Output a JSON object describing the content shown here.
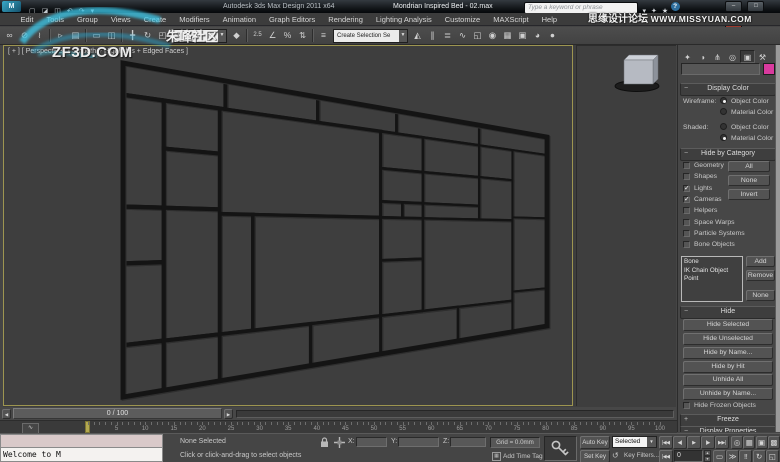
{
  "window": {
    "app_title": "Autodesk 3ds Max Design 2011 x64",
    "file_title": "Mondrian Inspired Bed - 02.max",
    "search_placeholder": "Type a keyword or phrase",
    "logo_text": "M",
    "buttons": {
      "minimize": "–",
      "maximize": "□",
      "close": "✕"
    },
    "qat_icons": [
      {
        "name": "new-scene-icon",
        "glyph": "▢"
      },
      {
        "name": "open-file-icon",
        "glyph": "◪"
      },
      {
        "name": "save-file-icon",
        "glyph": "◫"
      },
      {
        "name": "undo-icon",
        "glyph": "↶"
      },
      {
        "name": "redo-icon",
        "glyph": "↷"
      },
      {
        "name": "project-folder-icon",
        "glyph": "▾"
      }
    ],
    "infocenter_icons": [
      {
        "name": "search-go-icon",
        "glyph": "▾"
      },
      {
        "name": "communication-center-icon",
        "glyph": "✦"
      },
      {
        "name": "favorites-icon",
        "glyph": "★"
      },
      {
        "name": "help-icon",
        "glyph": "?"
      }
    ]
  },
  "watermarks": {
    "top_right_cn": "思缘设计论坛",
    "top_right_en": "WWW.MISSYUAN.COM",
    "toolbar_cn": "朱峰社区",
    "viewport_site": "ZF3D.COM"
  },
  "menus": [
    "Edit",
    "Tools",
    "Group",
    "Views",
    "Create",
    "Modifiers",
    "Animation",
    "Graph Editors",
    "Rendering",
    "Lighting Analysis",
    "Customize",
    "MAXScript",
    "Help"
  ],
  "toolbar": {
    "view_dropdown": "View",
    "selection_set_dropdown": "Create Selection Se",
    "icons": [
      {
        "name": "select-and-link-icon",
        "glyph": "∞"
      },
      {
        "name": "unlink-selection-icon",
        "glyph": "⊘"
      },
      {
        "name": "bind-to-space-warp-icon",
        "glyph": "≀"
      },
      {
        "name": "sep"
      },
      {
        "name": "select-object-icon",
        "glyph": "▹"
      },
      {
        "name": "select-by-name-icon",
        "glyph": "▤"
      },
      {
        "name": "sep"
      },
      {
        "name": "selection-region-icon",
        "glyph": "▭"
      },
      {
        "name": "window-crossing-icon",
        "glyph": "◫"
      },
      {
        "name": "sep"
      },
      {
        "name": "select-and-move-icon",
        "glyph": "╋"
      },
      {
        "name": "select-and-rotate-icon",
        "glyph": "↻"
      },
      {
        "name": "select-and-scale-icon",
        "glyph": "◰"
      },
      {
        "name": "dd-view"
      },
      {
        "name": "select-and-manipulate-icon",
        "glyph": "◆"
      },
      {
        "name": "sep"
      },
      {
        "name": "snap-toggle-icon",
        "glyph": "2.5"
      },
      {
        "name": "angle-snap-icon",
        "glyph": "∠"
      },
      {
        "name": "percent-snap-icon",
        "glyph": "%"
      },
      {
        "name": "spinner-snap-icon",
        "glyph": "⇅"
      },
      {
        "name": "sep"
      },
      {
        "name": "edit-named-selections-icon",
        "glyph": "≡"
      },
      {
        "name": "dd-selset"
      },
      {
        "name": "mirror-icon",
        "glyph": "◭"
      },
      {
        "name": "align-icon",
        "glyph": "∥"
      },
      {
        "name": "layer-manager-icon",
        "glyph": "≣"
      },
      {
        "name": "curve-editor-icon",
        "glyph": "∿"
      },
      {
        "name": "schematic-view-icon",
        "glyph": "◱"
      },
      {
        "name": "material-editor-icon",
        "glyph": "◉"
      },
      {
        "name": "render-setup-icon",
        "glyph": "▦"
      },
      {
        "name": "rendered-frame-window-icon",
        "glyph": "▣"
      },
      {
        "name": "render-production-icon",
        "glyph": "◕"
      },
      {
        "name": "render-iterative-icon",
        "glyph": "●"
      }
    ]
  },
  "viewport": {
    "label": "[ + ] [ Perspective ] [ Smooth + Highlights + Edged Faces ]",
    "lattice_rects": [
      [
        0,
        0,
        0.165,
        0.095
      ],
      [
        0.165,
        0,
        0.345,
        0.095
      ],
      [
        0.345,
        0,
        0.53,
        0.095
      ],
      [
        0.53,
        0,
        0.765,
        0.095
      ],
      [
        0.765,
        0,
        1,
        0.095
      ],
      [
        0,
        0.095,
        0.062,
        0.43
      ],
      [
        0,
        0.43,
        0.062,
        0.6
      ],
      [
        0,
        0.6,
        0.062,
        0.845
      ],
      [
        0,
        0.845,
        0.062,
        1
      ],
      [
        0.062,
        0.095,
        0.155,
        0.245
      ],
      [
        0.062,
        0.245,
        0.155,
        0.43
      ],
      [
        0.062,
        0.43,
        0.155,
        0.845
      ],
      [
        0.062,
        0.845,
        0.155,
        1
      ],
      [
        0.155,
        0.095,
        0.49,
        0.445
      ],
      [
        0.155,
        0.445,
        0.215,
        0.845
      ],
      [
        0.215,
        0.445,
        0.49,
        0.845
      ],
      [
        0.155,
        0.845,
        0.33,
        1
      ],
      [
        0.33,
        0.845,
        0.49,
        1
      ],
      [
        0.49,
        0.095,
        0.6,
        0.245
      ],
      [
        0.49,
        0.245,
        0.6,
        0.38
      ],
      [
        0.49,
        0.38,
        0.545,
        0.445
      ],
      [
        0.545,
        0.38,
        0.6,
        0.445
      ],
      [
        0.49,
        0.445,
        0.6,
        0.62
      ],
      [
        0.49,
        0.62,
        0.6,
        0.845
      ],
      [
        0.49,
        0.845,
        0.7,
        1
      ],
      [
        0.6,
        0.095,
        0.765,
        0.245
      ],
      [
        0.765,
        0.095,
        0.875,
        0.245
      ],
      [
        0.6,
        0.245,
        0.765,
        0.38
      ],
      [
        0.6,
        0.38,
        0.765,
        0.445
      ],
      [
        0.765,
        0.245,
        0.875,
        0.445
      ],
      [
        0.6,
        0.445,
        0.875,
        0.845
      ],
      [
        0.7,
        0.845,
        0.875,
        1
      ],
      [
        0.875,
        0.095,
        1,
        0.43
      ],
      [
        0.875,
        0.43,
        1,
        0.8
      ],
      [
        0.875,
        0.8,
        1,
        1
      ],
      [
        0,
        0,
        1,
        1
      ]
    ]
  },
  "command_panel": {
    "tabs": [
      {
        "name": "tab-create",
        "glyph": "✦",
        "active": false
      },
      {
        "name": "tab-modify",
        "glyph": "◑",
        "active": false
      },
      {
        "name": "tab-hierarchy",
        "glyph": "⋔",
        "active": false
      },
      {
        "name": "tab-motion",
        "glyph": "◎",
        "active": false
      },
      {
        "name": "tab-display",
        "glyph": "▣",
        "active": true
      },
      {
        "name": "tab-utilities",
        "glyph": "⚒",
        "active": false
      }
    ],
    "swatch_color": "#d93a9e",
    "display_color": {
      "title": "Display Color",
      "wireframe_label": "Wireframe:",
      "shaded_label": "Shaded:",
      "object_color": "Object Color",
      "material_color": "Material Color",
      "wireframe_selected": "object",
      "shaded_selected": "material"
    },
    "hide_by_category": {
      "title": "Hide by Category",
      "categories": [
        {
          "label": "Geometry",
          "checked": false
        },
        {
          "label": "Shapes",
          "checked": false
        },
        {
          "label": "Lights",
          "checked": true
        },
        {
          "label": "Cameras",
          "checked": true
        },
        {
          "label": "Helpers",
          "checked": false
        },
        {
          "label": "Space Warps",
          "checked": false
        },
        {
          "label": "Particle Systems",
          "checked": false
        },
        {
          "label": "Bone Objects",
          "checked": false
        }
      ],
      "buttons": [
        "All",
        "None",
        "Invert"
      ],
      "list_items": [
        "Bone",
        "IK Chain Object",
        "Point"
      ],
      "list_buttons": [
        "Add",
        "Remove",
        "None"
      ]
    },
    "hide": {
      "title": "Hide",
      "buttons_group1": [
        "Hide Selected",
        "Hide Unselected",
        "Hide by Name...",
        "Hide by Hit"
      ],
      "buttons_group2": [
        "Unhide All",
        "Unhide by Name..."
      ],
      "checkbox": "Hide Frozen Objects"
    },
    "freeze_title": "Freeze",
    "display_properties_title": "Display Properties"
  },
  "timeline": {
    "slider_value": "0 / 100",
    "tick_labels": [
      "5",
      "10",
      "15",
      "20",
      "25",
      "30",
      "35",
      "40",
      "45",
      "50",
      "55",
      "60",
      "65",
      "70",
      "75",
      "80",
      "85",
      "90",
      "95",
      "100"
    ]
  },
  "status_bar": {
    "listener_text": "Welcome to M",
    "status": "None Selected",
    "prompt": "Click or click-and-drag to select objects",
    "x_label": "X:",
    "y_label": "Y:",
    "z_label": "Z:",
    "grid": "Grid = 0.0mm",
    "add_time_tag": "Add Time Tag",
    "auto_key": "Auto Key",
    "set_key": "Set Key",
    "selected_dropdown": "Selected",
    "key_filters": "Key Filters...",
    "frame_field": "0",
    "playback": [
      {
        "name": "go-to-start-button",
        "glyph": "|◀◀"
      },
      {
        "name": "previous-frame-button",
        "glyph": "◀|"
      },
      {
        "name": "play-button",
        "glyph": "▶"
      },
      {
        "name": "next-frame-button",
        "glyph": "|▶"
      },
      {
        "name": "go-to-end-button",
        "glyph": "▶▶|"
      }
    ],
    "key_mode_glyph": "|◀◀",
    "nav_row1": [
      {
        "name": "zoom-icon",
        "glyph": "◎"
      },
      {
        "name": "zoom-all-icon",
        "glyph": "▦"
      },
      {
        "name": "zoom-extents-icon",
        "glyph": "▣"
      },
      {
        "name": "zoom-extents-all-icon",
        "glyph": "▩"
      }
    ],
    "nav_row2": [
      {
        "name": "zoom-region-icon",
        "glyph": "▭"
      },
      {
        "name": "pan-icon",
        "glyph": "≫"
      },
      {
        "name": "walk-through-icon",
        "glyph": "‼"
      },
      {
        "name": "orbit-icon",
        "glyph": "↻"
      },
      {
        "name": "maximize-viewport-icon",
        "glyph": "◱"
      }
    ]
  },
  "colors": {
    "viewport_border": "#9d9550",
    "beam": "#141414",
    "swatch": "#d93a9e"
  }
}
